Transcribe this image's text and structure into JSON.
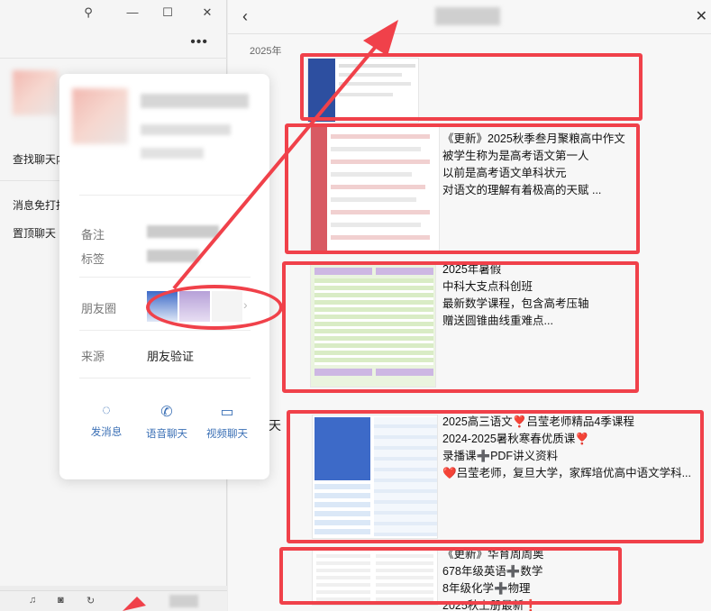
{
  "left_window": {
    "menu_items": [
      "查找聊天内",
      "消息免打扰",
      "置顶聊天"
    ]
  },
  "profile_card": {
    "fields": [
      {
        "label": "备注"
      },
      {
        "label": "标签"
      },
      {
        "label": "朋友圈"
      },
      {
        "label": "来源",
        "value": "朋友验证"
      }
    ],
    "actions": [
      {
        "label": "发消息",
        "icon": "chat-bubble-icon"
      },
      {
        "label": "语音聊天",
        "icon": "phone-icon"
      },
      {
        "label": "视频聊天",
        "icon": "video-camera-icon"
      }
    ]
  },
  "moments": {
    "year": "2025年",
    "side_text": "天",
    "posts": [
      {
        "lines": []
      },
      {
        "lines": [
          "《更新》2025秋季叁月聚粮高中作文",
          "被学生称为是高考语文第一人",
          " 以前是高考语文单科状元",
          "对语文的理解有着极高的天赋 ..."
        ]
      },
      {
        "lines": [
          "2025年暑假",
          "中科大支点科创班",
          "最新数学课程，包含高考压轴",
          "赠送圆锥曲线重难点..."
        ]
      },
      {
        "lines": [
          "2025高三语文❣️吕莹老师精品4季课程",
          "2024-2025暑秋寒春优质课❣️",
          "录播课➕PDF讲义资料",
          "❤️吕莹老师，复旦大学，家辉培优高中语文学科..."
        ]
      },
      {
        "lines": [
          "《更新》华育周周奥",
          "678年级英语➕数学",
          "8年级化学➕物理",
          "2025秋上册最新❗"
        ]
      }
    ]
  },
  "colors": {
    "annotation_red": "#f0414a",
    "action_blue": "#3a6fb5"
  }
}
